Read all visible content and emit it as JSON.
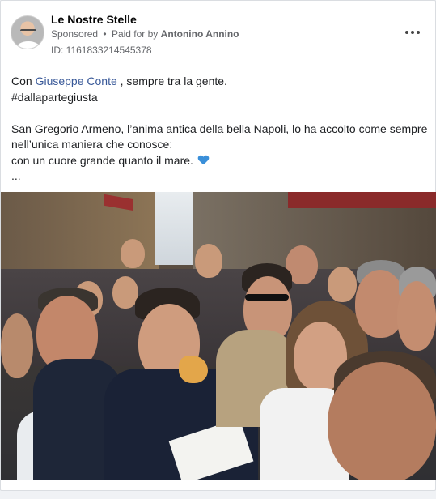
{
  "post": {
    "page_name": "Le Nostre Stelle",
    "sponsored_label": "Sponsored",
    "separator": "•",
    "paid_for_prefix": "Paid for by",
    "advertiser": "Antonino Annino",
    "ad_id": "ID: 1161833214545378",
    "more_icon": "more-horizontal-icon"
  },
  "message": {
    "line1_before": "Con",
    "mention": "Giuseppe Conte",
    "line1_after": ", sempre tra la gente.",
    "hashtag": "#dallapartegiusta",
    "line3": "San Gregorio Armeno, l’anima antica della bella Napoli, lo ha accolto come sempre",
    "line4": "nell’unica maniera che conosce:",
    "line5": "con un cuore grande quanto il mare.",
    "heart_icon": "blue-heart-emoji-icon",
    "heart_color": "#3a8fd9",
    "ellipsis": "..."
  },
  "colors": {
    "link": "#385898",
    "secondary_text": "#65676b",
    "card_bg": "#ffffff",
    "page_bg": "#f0f2f5"
  }
}
